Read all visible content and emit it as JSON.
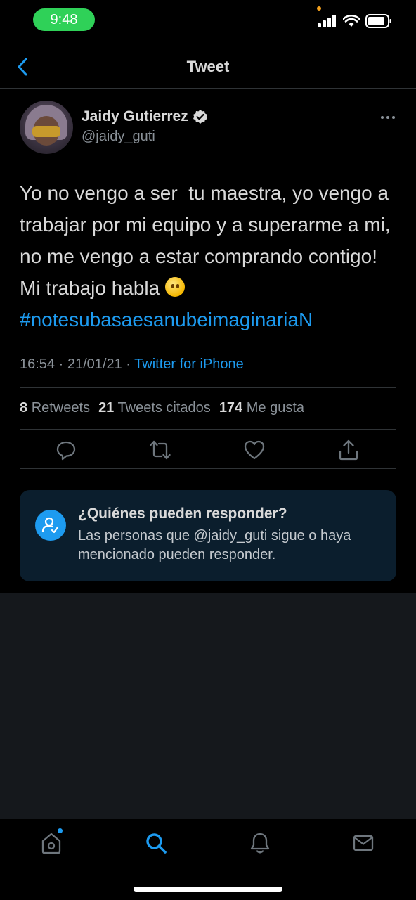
{
  "status_bar": {
    "time": "9:48"
  },
  "header": {
    "title": "Tweet"
  },
  "author": {
    "name": "Jaidy Gutierrez",
    "handle": "@jaidy_guti"
  },
  "tweet": {
    "text": "Yo no vengo a ser  tu maestra, yo vengo a trabajar por mi equipo y a superarme a mi, no me vengo a estar comprando contigo! Mi trabajo habla ",
    "emoji": "neutral-face-emoji",
    "hashtag": "#notesubasaesanubeimaginariaN",
    "time": "16:54",
    "date": "21/01/21",
    "separator": "·",
    "source": "Twitter for iPhone"
  },
  "stats": {
    "retweets_count": "8",
    "retweets_label": "Retweets",
    "quotes_count": "21",
    "quotes_label": "Tweets citados",
    "likes_count": "174",
    "likes_label": "Me gusta"
  },
  "reply_card": {
    "title": "¿Quiénes pueden responder?",
    "body": "Las personas que @jaidy_guti sigue o haya mencionado pueden responder."
  },
  "colors": {
    "accent": "#1d9bf0",
    "verified": "#d9d9d9",
    "background": "#000000"
  }
}
